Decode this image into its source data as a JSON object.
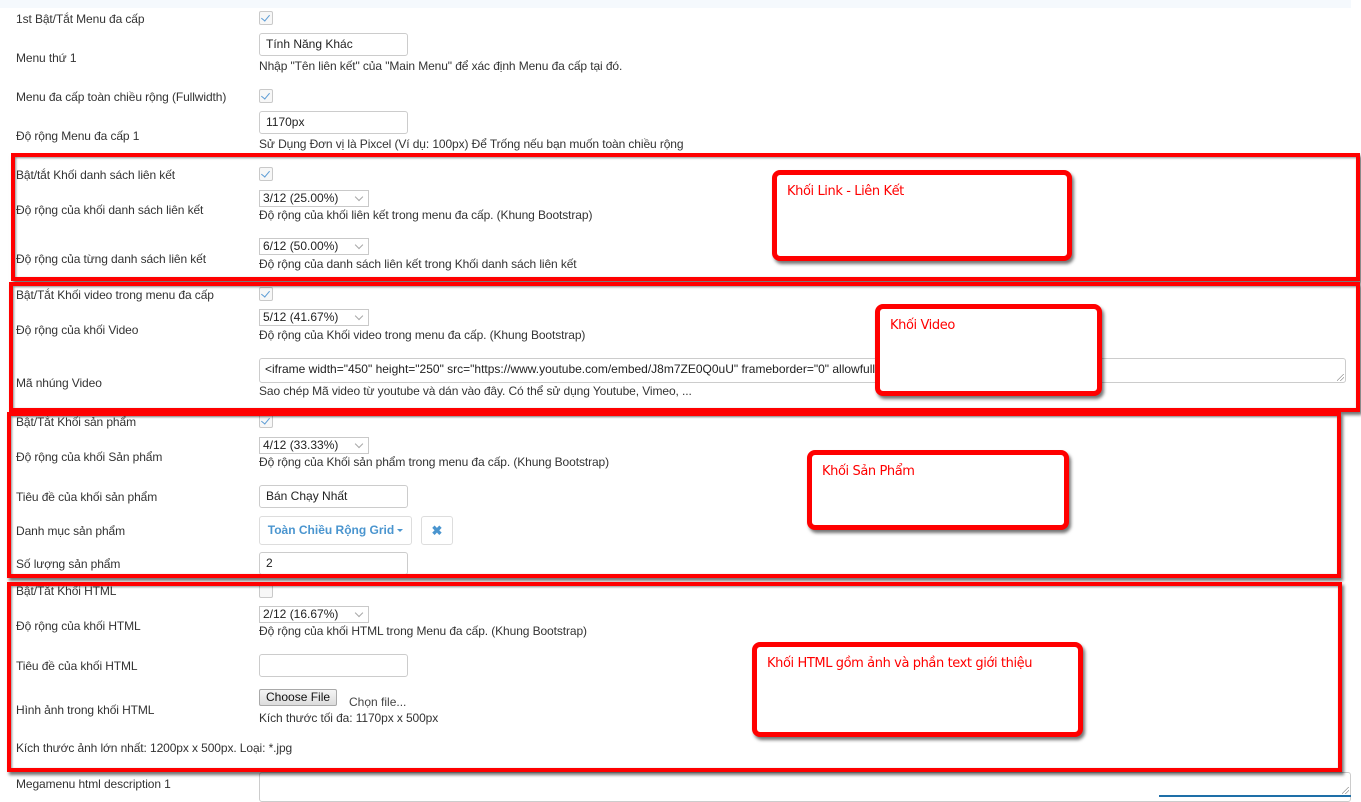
{
  "fields": {
    "menu_toggle": {
      "label": "1st Bật/Tắt Menu đa cấp",
      "checked": true
    },
    "menu_name": {
      "label": "Menu thứ 1",
      "value": "Tính Năng Khác",
      "help": "Nhập \"Tên liên kết\" của \"Main Menu\" để xác định Menu đa cấp tại đó."
    },
    "fullwidth": {
      "label": "Menu đa cấp toàn chiều rộng (Fullwidth)",
      "checked": true
    },
    "menu_width": {
      "label": "Độ rộng Menu đa cấp 1",
      "value": "1170px",
      "help": "Sử Dụng Đơn vị là Pixcel (Ví dụ: 100px) Để Trống nếu bạn muốn toàn chiều rộng"
    },
    "links_toggle": {
      "label": "Bật/tắt Khối danh sách liên kết",
      "checked": true
    },
    "links_block_width": {
      "label": "Độ rộng của khối danh sách liên kết",
      "value": "3/12 (25.00%)",
      "help": "Độ rộng của khối liên kết trong menu đa cấp. (Khung Bootstrap)"
    },
    "links_list_width": {
      "label": "Độ rộng của từng danh sách liên kết",
      "value": "6/12 (50.00%)",
      "help": "Độ rộng của danh sách liên kết trong Khối danh sách liên kết"
    },
    "video_toggle": {
      "label": "Bật/Tắt Khối video trong menu đa cấp",
      "checked": true
    },
    "video_width": {
      "label": "Độ rộng của khối Video",
      "value": "5/12 (41.67%)",
      "help": "Độ rộng của Khối video trong menu đa cấp. (Khung Bootstrap)"
    },
    "video_embed": {
      "label": "Mã nhúng Video",
      "value": "<iframe width=\"450\" height=\"250\" src=\"https://www.youtube.com/embed/J8m7ZE0Q0uU\" frameborder=\"0\" allowfullscreen></iframe>",
      "help": "Sao chép Mã video từ youtube và dán vào đây. Có thể sử dụng Youtube, Vimeo, ..."
    },
    "product_toggle": {
      "label": "Bật/Tắt Khối sản phẩm",
      "checked": true
    },
    "product_width": {
      "label": "Độ rộng của khối Sản phẩm",
      "value": "4/12 (33.33%)",
      "help": "Độ rộng của Khối sản phẩm trong menu đa cấp. (Khung Bootstrap)"
    },
    "product_title": {
      "label": "Tiêu đề của khối sản phẩm",
      "value": "Bán Chạy Nhất"
    },
    "product_category": {
      "label": "Danh mục sản phẩm",
      "value": "Toàn Chiều Rộng Grid",
      "clear_icon": "✖"
    },
    "product_count": {
      "label": "Số lượng sản phẩm",
      "value": "2"
    },
    "html_toggle": {
      "label": "Bật/Tắt Khối HTML",
      "checked": false
    },
    "html_width": {
      "label": "Độ rộng của khối HTML",
      "value": "2/12 (16.67%)",
      "help": "Độ rộng của khối HTML trong Menu đa cấp. (Khung Bootstrap)"
    },
    "html_title": {
      "label": "Tiêu đề của khối HTML",
      "value": ""
    },
    "html_image": {
      "label": "Hình ảnh trong khối HTML",
      "button": "Choose File",
      "file_name": "Chọn file...",
      "help": "Kích thước tối đa: 1170px x 500px"
    },
    "html_image_note": {
      "label": "Kích thước ảnh lớn nhất: 1200px x 500px. Loại: *.jpg"
    },
    "html_description": {
      "label": "Megamenu html description 1",
      "value": ""
    }
  },
  "annotations": {
    "links": "Khối Link - Liên Kết",
    "video": "Khối Video",
    "product": "Khối Sản Phẩm",
    "html": "Khối HTML gồm ảnh và phần text giới thiệu",
    "color": "#ff0000"
  }
}
